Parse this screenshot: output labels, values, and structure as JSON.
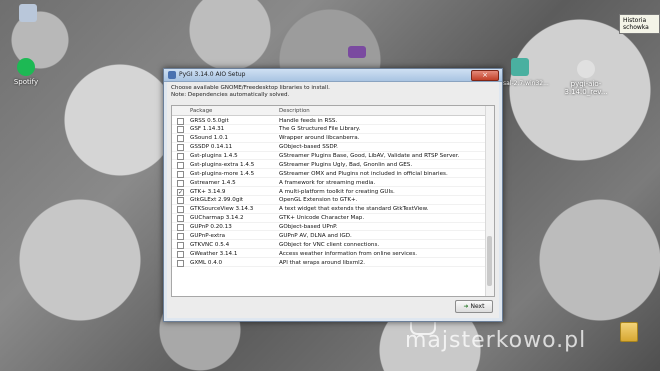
{
  "desktop": {
    "icons": [
      {
        "label": "",
        "icon": "monitor-icon",
        "color": "#b9c7da"
      },
      {
        "label": "Spotify",
        "icon": "spotify-icon",
        "color": "#1db954"
      },
      {
        "label": "",
        "icon": "archive-icon",
        "color": "#7a4aa0"
      },
      {
        "label": "",
        "icon": "window-icon",
        "color": "#4ab0a0"
      },
      {
        "label": "pygi-aio-3.14.0_rev...",
        "icon": "gnome-installer-icon",
        "color": "#e0e0e0"
      },
      {
        "label": "",
        "icon": "folder-icon",
        "color": "#e7c05b"
      }
    ],
    "left_cut_label": "sal-2.7.win32...",
    "tooltip": "Historia schowka",
    "watermark": "majsterkowo.pl"
  },
  "window": {
    "title": "PyGI 3.14.0 AIO Setup",
    "close_label": "×",
    "instruction": "Choose available GNOME/Freedesktop libraries to install.\nNote: Dependencies automatically solved.",
    "columns": {
      "package": "Package",
      "description": "Description"
    },
    "rows": [
      {
        "package": "GRSS 0.5.0git",
        "description": "Handle feeds in RSS.",
        "checked": false
      },
      {
        "package": "GSF 1.14.31",
        "description": "The G Structured File Library.",
        "checked": false
      },
      {
        "package": "GSound 1.0.1",
        "description": "Wrapper around libcanberra.",
        "checked": false
      },
      {
        "package": "GSSDP 0.14.11",
        "description": "GObject-based SSDP.",
        "checked": false
      },
      {
        "package": "Gst-plugins 1.4.5",
        "description": "GStreamer Plugins Base, Good, LibAV, Validate and RTSP Server.",
        "checked": false
      },
      {
        "package": "Gst-plugins-extra 1.4.5",
        "description": "GStreamer Plugins Ugly, Bad, Gnonlin and GES.",
        "checked": false
      },
      {
        "package": "Gst-plugins-more 1.4.5",
        "description": "GStreamer OMX and Plugins not included in official binaries.",
        "checked": false
      },
      {
        "package": "Gstreamer 1.4.5",
        "description": "A framework for streaming media.",
        "checked": false
      },
      {
        "package": "GTK+ 3.14.9",
        "description": "A multi-platform toolkit for creating GUIs.",
        "checked": true
      },
      {
        "package": "GtkGLExt 2.99.0git",
        "description": "OpenGL Extension to GTK+.",
        "checked": false
      },
      {
        "package": "GTKSourceView 3.14.3",
        "description": "A text widget that extends the standard GtkTextView.",
        "checked": false
      },
      {
        "package": "GUCharmap 3.14.2",
        "description": "GTK+ Unicode Character Map.",
        "checked": false
      },
      {
        "package": "GUPnP 0.20.13",
        "description": "GObject-based UPnP.",
        "checked": false
      },
      {
        "package": "GUPnP-extra",
        "description": "GUPnP AV, DLNA and IGD.",
        "checked": false
      },
      {
        "package": "GTKVNC 0.5.4",
        "description": "GObject for VNC client connections.",
        "checked": false
      },
      {
        "package": "GWeather 3.14.1",
        "description": "Access weather information from online services.",
        "checked": false
      },
      {
        "package": "GXML 0.4.0",
        "description": "API that wraps around libxml2.",
        "checked": false
      }
    ],
    "next_label": "Next",
    "next_icon": "arrow-right-icon"
  }
}
